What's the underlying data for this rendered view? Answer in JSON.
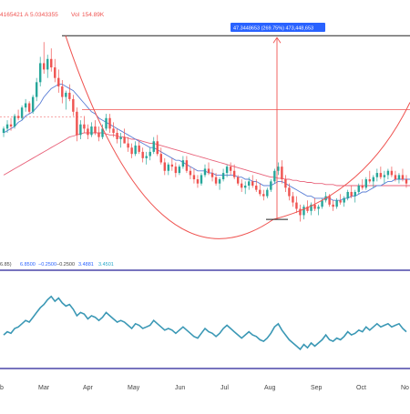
{
  "header": {
    "ohlc_prefix": "4165421",
    "close_prefix": "A",
    "close_value": "5.0343355",
    "vol_label": "Vol",
    "vol_value": "154.89K"
  },
  "measure_label": "47.3448653 (269.75%) 473,448,653",
  "indicator_legend": {
    "params": "6.85)",
    "v1": "6.8500",
    "v2": "−0.2500",
    "v3": "−0.2500",
    "v4": "3.4881",
    "v5": "3.4501"
  },
  "colors": {
    "up": "#26a69a",
    "down": "#ef5350",
    "ma_blue": "#5b7fd6",
    "ma_pink": "#e8627a",
    "arc": "#ef5350",
    "indicator": "#3b98b5",
    "indicator_band": "#4a47a8",
    "measure_box": "#2962ff"
  },
  "chart_data": {
    "type": "candlestick",
    "x_axis_labels": [
      "b",
      "Mar",
      "Apr",
      "May",
      "Jun",
      "Jul",
      "Aug",
      "Sep",
      "Oct",
      "No"
    ],
    "price_range": [
      0,
      10
    ],
    "candles": [
      [
        5.0,
        5.3,
        4.8,
        5.2
      ],
      [
        5.2,
        5.6,
        5.0,
        5.4
      ],
      [
        5.4,
        5.7,
        5.1,
        5.3
      ],
      [
        5.3,
        5.9,
        5.2,
        5.8
      ],
      [
        5.8,
        6.1,
        5.6,
        5.7
      ],
      [
        5.7,
        6.3,
        5.6,
        6.2
      ],
      [
        6.2,
        6.6,
        6.0,
        6.4
      ],
      [
        6.4,
        6.5,
        5.9,
        6.0
      ],
      [
        6.0,
        6.8,
        5.9,
        6.7
      ],
      [
        6.7,
        7.6,
        6.5,
        7.4
      ],
      [
        7.4,
        8.6,
        7.2,
        8.3
      ],
      [
        8.3,
        9.3,
        7.8,
        8.0
      ],
      [
        8.0,
        8.7,
        7.6,
        8.5
      ],
      [
        8.5,
        9.0,
        7.9,
        8.1
      ],
      [
        8.1,
        8.5,
        7.4,
        7.6
      ],
      [
        7.6,
        8.0,
        6.9,
        7.2
      ],
      [
        7.2,
        7.5,
        6.4,
        6.7
      ],
      [
        6.7,
        7.0,
        6.1,
        6.9
      ],
      [
        6.9,
        7.3,
        6.5,
        6.6
      ],
      [
        6.6,
        6.8,
        5.8,
        6.0
      ],
      [
        6.0,
        6.2,
        4.6,
        4.9
      ],
      [
        4.9,
        5.6,
        4.7,
        5.4
      ],
      [
        5.4,
        5.8,
        5.0,
        5.2
      ],
      [
        5.2,
        5.4,
        4.7,
        4.9
      ],
      [
        4.9,
        5.5,
        4.8,
        5.3
      ],
      [
        5.3,
        5.6,
        4.9,
        5.0
      ],
      [
        5.0,
        5.3,
        4.6,
        4.8
      ],
      [
        4.8,
        5.4,
        4.7,
        5.2
      ],
      [
        5.2,
        5.9,
        5.1,
        5.7
      ],
      [
        5.7,
        5.9,
        5.0,
        5.2
      ],
      [
        5.2,
        5.5,
        4.8,
        5.0
      ],
      [
        5.0,
        5.2,
        4.5,
        4.7
      ],
      [
        4.7,
        5.0,
        4.3,
        4.8
      ],
      [
        4.8,
        5.2,
        4.6,
        4.5
      ],
      [
        4.5,
        4.8,
        4.1,
        4.3
      ],
      [
        4.3,
        4.5,
        3.8,
        4.0
      ],
      [
        4.0,
        4.6,
        3.9,
        4.4
      ],
      [
        4.4,
        4.6,
        4.0,
        4.1
      ],
      [
        4.1,
        4.3,
        3.6,
        3.8
      ],
      [
        3.8,
        4.1,
        3.5,
        3.9
      ],
      [
        3.9,
        4.3,
        3.7,
        4.1
      ],
      [
        4.1,
        4.8,
        4.0,
        4.6
      ],
      [
        4.6,
        4.9,
        3.9,
        4.0
      ],
      [
        4.0,
        4.3,
        3.5,
        3.6
      ],
      [
        3.6,
        3.8,
        3.0,
        3.2
      ],
      [
        3.2,
        3.6,
        3.0,
        3.5
      ],
      [
        3.5,
        3.8,
        3.2,
        3.4
      ],
      [
        3.4,
        3.6,
        2.9,
        3.1
      ],
      [
        3.1,
        3.5,
        3.0,
        3.4
      ],
      [
        3.4,
        3.9,
        3.3,
        3.7
      ],
      [
        3.7,
        3.9,
        3.1,
        3.2
      ],
      [
        3.2,
        3.4,
        2.8,
        3.0
      ],
      [
        3.0,
        3.3,
        2.6,
        2.8
      ],
      [
        2.8,
        3.0,
        2.4,
        2.6
      ],
      [
        2.6,
        3.1,
        2.5,
        3.0
      ],
      [
        3.0,
        3.5,
        2.9,
        3.3
      ],
      [
        3.3,
        3.6,
        3.0,
        3.1
      ],
      [
        3.1,
        3.3,
        2.7,
        2.9
      ],
      [
        2.9,
        3.1,
        2.5,
        2.6
      ],
      [
        2.6,
        2.9,
        2.3,
        2.8
      ],
      [
        2.8,
        3.3,
        2.7,
        3.1
      ],
      [
        3.1,
        3.5,
        2.9,
        3.4
      ],
      [
        3.4,
        3.6,
        3.0,
        3.2
      ],
      [
        3.2,
        3.5,
        2.8,
        2.9
      ],
      [
        2.9,
        3.0,
        2.5,
        2.6
      ],
      [
        2.6,
        2.8,
        2.2,
        2.4
      ],
      [
        2.4,
        2.7,
        2.1,
        2.5
      ],
      [
        2.5,
        2.9,
        2.3,
        2.7
      ],
      [
        2.7,
        3.0,
        2.4,
        2.5
      ],
      [
        2.5,
        2.8,
        2.2,
        2.3
      ],
      [
        2.3,
        2.6,
        2.0,
        2.1
      ],
      [
        2.1,
        2.3,
        1.8,
        2.0
      ],
      [
        2.0,
        2.4,
        1.9,
        2.3
      ],
      [
        2.3,
        2.8,
        2.2,
        2.7
      ],
      [
        2.7,
        3.3,
        2.6,
        3.2
      ],
      [
        3.2,
        3.6,
        3.0,
        3.4
      ],
      [
        3.4,
        3.7,
        2.6,
        2.8
      ],
      [
        2.8,
        3.0,
        2.2,
        2.4
      ],
      [
        2.4,
        2.6,
        1.8,
        2.0
      ],
      [
        2.0,
        2.2,
        1.5,
        1.7
      ],
      [
        1.7,
        2.0,
        1.2,
        1.4
      ],
      [
        1.4,
        1.6,
        0.8,
        1.1
      ],
      [
        1.1,
        1.6,
        0.9,
        1.5
      ],
      [
        1.5,
        1.8,
        1.2,
        1.3
      ],
      [
        1.3,
        1.7,
        1.1,
        1.6
      ],
      [
        1.6,
        1.9,
        1.3,
        1.4
      ],
      [
        1.4,
        1.6,
        1.1,
        1.5
      ],
      [
        1.5,
        1.9,
        1.4,
        1.8
      ],
      [
        1.8,
        2.2,
        1.7,
        2.0
      ],
      [
        2.0,
        2.1,
        1.5,
        1.6
      ],
      [
        1.6,
        1.8,
        1.3,
        1.5
      ],
      [
        1.5,
        1.9,
        1.4,
        1.8
      ],
      [
        1.8,
        2.1,
        1.6,
        1.7
      ],
      [
        1.7,
        2.0,
        1.5,
        1.9
      ],
      [
        1.9,
        2.3,
        1.8,
        2.2
      ],
      [
        2.2,
        2.5,
        1.9,
        2.0
      ],
      [
        2.0,
        2.3,
        1.7,
        2.2
      ],
      [
        2.2,
        2.6,
        2.1,
        2.5
      ],
      [
        2.5,
        2.8,
        2.3,
        2.4
      ],
      [
        2.4,
        2.9,
        2.3,
        2.8
      ],
      [
        2.8,
        3.2,
        2.6,
        2.7
      ],
      [
        2.7,
        3.0,
        2.4,
        2.9
      ],
      [
        2.9,
        3.3,
        2.7,
        3.1
      ],
      [
        3.1,
        3.4,
        2.8,
        2.9
      ],
      [
        2.9,
        3.2,
        2.6,
        3.0
      ],
      [
        3.0,
        3.3,
        2.8,
        3.2
      ],
      [
        3.2,
        3.4,
        2.9,
        3.0
      ],
      [
        3.0,
        3.2,
        2.7,
        2.8
      ],
      [
        2.8,
        3.1,
        2.6,
        3.0
      ],
      [
        3.0,
        3.3,
        2.7,
        2.8
      ],
      [
        2.8,
        3.0,
        2.4,
        2.6
      ]
    ],
    "ma_short": [
      5.0,
      5.1,
      5.2,
      5.3,
      5.5,
      5.6,
      5.8,
      5.9,
      6.0,
      6.2,
      6.4,
      6.7,
      6.9,
      7.1,
      7.2,
      7.3,
      7.3,
      7.2,
      7.1,
      7.0,
      6.8,
      6.6,
      6.4,
      6.2,
      6.0,
      5.9,
      5.7,
      5.6,
      5.5,
      5.4,
      5.3,
      5.2,
      5.1,
      5.0,
      4.9,
      4.8,
      4.7,
      4.6,
      4.5,
      4.4,
      4.3,
      4.3,
      4.2,
      4.1,
      4.0,
      3.9,
      3.8,
      3.7,
      3.7,
      3.6,
      3.5,
      3.4,
      3.3,
      3.2,
      3.2,
      3.2,
      3.1,
      3.1,
      3.0,
      3.0,
      3.0,
      3.0,
      3.0,
      3.0,
      2.9,
      2.9,
      2.8,
      2.8,
      2.7,
      2.7,
      2.6,
      2.5,
      2.5,
      2.5,
      2.6,
      2.7,
      2.7,
      2.6,
      2.5,
      2.4,
      2.3,
      2.2,
      2.1,
      2.0,
      2.0,
      1.9,
      1.9,
      1.9,
      1.9,
      1.9,
      1.8,
      1.8,
      1.8,
      1.9,
      1.9,
      2.0,
      2.0,
      2.1,
      2.2,
      2.2,
      2.3,
      2.4,
      2.5,
      2.5,
      2.6,
      2.7,
      2.7,
      2.8,
      2.8,
      2.8,
      2.8,
      2.8,
      2.8
    ],
    "ma_long": [
      3.0,
      3.1,
      3.2,
      3.3,
      3.4,
      3.5,
      3.6,
      3.7,
      3.8,
      3.9,
      4.0,
      4.1,
      4.2,
      4.3,
      4.4,
      4.5,
      4.6,
      4.7,
      4.8,
      4.85,
      4.9,
      4.95,
      5.0,
      5.0,
      5.0,
      5.0,
      5.0,
      5.0,
      4.95,
      4.9,
      4.9,
      4.85,
      4.8,
      4.8,
      4.75,
      4.7,
      4.7,
      4.65,
      4.6,
      4.55,
      4.5,
      4.5,
      4.45,
      4.4,
      4.35,
      4.3,
      4.25,
      4.2,
      4.15,
      4.1,
      4.05,
      4.0,
      3.95,
      3.9,
      3.85,
      3.8,
      3.75,
      3.7,
      3.65,
      3.6,
      3.55,
      3.5,
      3.45,
      3.4,
      3.35,
      3.3,
      3.25,
      3.2,
      3.15,
      3.1,
      3.05,
      3.0,
      2.95,
      2.9,
      2.9,
      2.85,
      2.85,
      2.8,
      2.8,
      2.75,
      2.75,
      2.7,
      2.7,
      2.65,
      2.65,
      2.6,
      2.6,
      2.6,
      2.55,
      2.55,
      2.55,
      2.5,
      2.5,
      2.5,
      2.5,
      2.5,
      2.5,
      2.5,
      2.5,
      2.5,
      2.5,
      2.5,
      2.5,
      2.5,
      2.5,
      2.5,
      2.5,
      2.5,
      2.5,
      2.5,
      2.5,
      2.5,
      2.5
    ],
    "indicator": [
      4.2,
      4.4,
      4.3,
      4.6,
      4.7,
      4.9,
      5.1,
      5.0,
      5.3,
      5.6,
      5.9,
      6.1,
      6.4,
      6.6,
      6.3,
      6.5,
      6.2,
      6.0,
      6.1,
      5.8,
      5.4,
      5.6,
      5.5,
      5.2,
      5.4,
      5.3,
      5.1,
      5.3,
      5.6,
      5.4,
      5.2,
      5.0,
      5.1,
      5.0,
      4.8,
      4.6,
      4.9,
      4.8,
      4.6,
      4.7,
      4.8,
      5.1,
      4.9,
      4.7,
      4.5,
      4.6,
      4.5,
      4.3,
      4.5,
      4.7,
      4.5,
      4.3,
      4.1,
      4.0,
      4.3,
      4.6,
      4.4,
      4.3,
      4.1,
      4.3,
      4.6,
      4.8,
      4.6,
      4.4,
      4.2,
      4.0,
      4.2,
      4.4,
      4.2,
      4.1,
      3.9,
      3.8,
      4.0,
      4.3,
      4.7,
      4.9,
      4.5,
      4.2,
      3.9,
      3.7,
      3.5,
      3.3,
      3.6,
      3.4,
      3.7,
      3.5,
      3.7,
      3.9,
      4.2,
      3.9,
      3.8,
      4.0,
      3.9,
      4.1,
      4.4,
      4.2,
      4.3,
      4.5,
      4.4,
      4.7,
      4.5,
      4.7,
      4.9,
      4.7,
      4.8,
      4.9,
      4.7,
      4.8,
      4.9,
      4.6,
      4.4
    ],
    "arc_top_price": 9.6,
    "resistance_price": 6.1,
    "arc_bottom_price": 0.9
  }
}
